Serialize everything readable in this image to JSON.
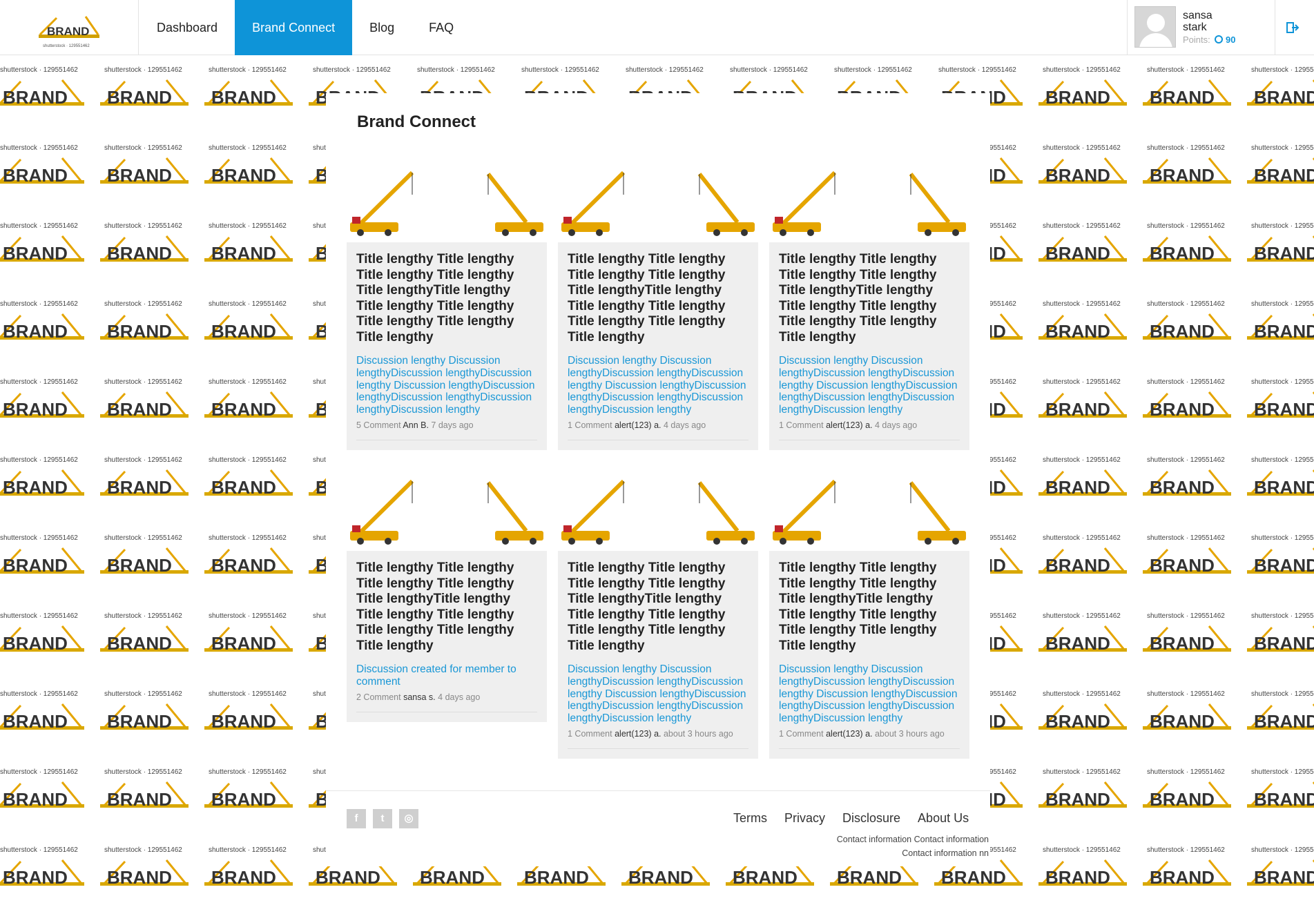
{
  "header": {
    "logo_text": "BRAND",
    "logo_caption": "shutterstock · 129551462",
    "nav": [
      {
        "label": "Dashboard",
        "active": false
      },
      {
        "label": "Brand Connect",
        "active": true
      },
      {
        "label": "Blog",
        "active": false
      },
      {
        "label": "FAQ",
        "active": false
      }
    ],
    "user": {
      "first_name": "sansa",
      "last_name": "stark",
      "points_label": "Points:",
      "points_value": "90"
    }
  },
  "background": {
    "tile_caption": "shutterstock · 129551462",
    "tile_logo_text": "BRAND"
  },
  "main": {
    "title": "Brand Connect",
    "cards": [
      {
        "title": "Title lengthy Title lengthy Title lengthy Title lengthy Title lengthyTitle lengthy Title lengthy Title lengthy Title lengthy Title lengthy Title lengthy",
        "description": "Discussion lengthy Discussion lengthyDiscussion lengthyDiscussion lengthy Discussion lengthyDiscussion lengthyDiscussion lengthyDiscussion lengthyDiscussion lengthy",
        "comments": "5 Comment",
        "author": "Ann B.",
        "time": "7 days ago"
      },
      {
        "title": "Title lengthy Title lengthy Title lengthy Title lengthy Title lengthyTitle lengthy Title lengthy Title lengthy Title lengthy Title lengthy Title lengthy",
        "description": "Discussion lengthy Discussion lengthyDiscussion lengthyDiscussion lengthy Discussion lengthyDiscussion lengthyDiscussion lengthyDiscussion lengthyDiscussion lengthy",
        "comments": "1 Comment",
        "author": "alert(123) a.",
        "time": "4 days ago"
      },
      {
        "title": "Title lengthy Title lengthy Title lengthy Title lengthy Title lengthyTitle lengthy Title lengthy Title lengthy Title lengthy Title lengthy Title lengthy",
        "description": "Discussion lengthy Discussion lengthyDiscussion lengthyDiscussion lengthy Discussion lengthyDiscussion lengthyDiscussion lengthyDiscussion lengthyDiscussion lengthy",
        "comments": "1 Comment",
        "author": "alert(123) a.",
        "time": "4 days ago"
      },
      {
        "title": "Title lengthy Title lengthy Title lengthy Title lengthy Title lengthyTitle lengthy Title lengthy Title lengthy Title lengthy Title lengthy Title lengthy",
        "description": "Discussion created for member to comment",
        "comments": "2 Comment",
        "author": "sansa s.",
        "time": "4 days ago"
      },
      {
        "title": "Title lengthy Title lengthy Title lengthy Title lengthy Title lengthyTitle lengthy Title lengthy Title lengthy Title lengthy Title lengthy Title lengthy",
        "description": "Discussion lengthy Discussion lengthyDiscussion lengthyDiscussion lengthy Discussion lengthyDiscussion lengthyDiscussion lengthyDiscussion lengthyDiscussion lengthy",
        "comments": "1 Comment",
        "author": "alert(123) a.",
        "time": "about 3 hours ago"
      },
      {
        "title": "Title lengthy Title lengthy Title lengthy Title lengthy Title lengthyTitle lengthy Title lengthy Title lengthy Title lengthy Title lengthy Title lengthy",
        "description": "Discussion lengthy Discussion lengthyDiscussion lengthyDiscussion lengthy Discussion lengthyDiscussion lengthyDiscussion lengthyDiscussion lengthyDiscussion lengthy",
        "comments": "1 Comment",
        "author": "alert(123) a.",
        "time": "about 3 hours ago"
      }
    ]
  },
  "footer": {
    "social": [
      {
        "icon": "facebook-icon",
        "glyph": "f"
      },
      {
        "icon": "twitter-icon",
        "glyph": "t"
      },
      {
        "icon": "instagram-icon",
        "glyph": "◎"
      }
    ],
    "links": [
      "Terms",
      "Privacy",
      "Disclosure",
      "About Us"
    ],
    "contact_line1": "Contact information Contact information",
    "contact_line2": "Contact information nn"
  },
  "colors": {
    "accent": "#0e94d8",
    "link": "#1997d6",
    "card_bg": "#efefef"
  }
}
